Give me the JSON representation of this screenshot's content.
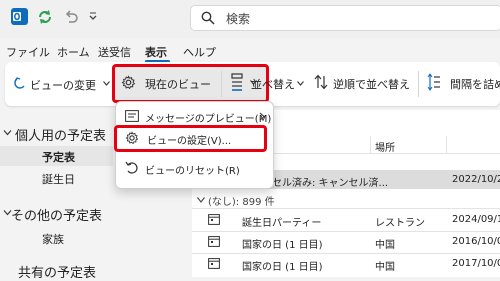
{
  "titlebar": {
    "search_placeholder": "検索"
  },
  "menu_tabs": [
    {
      "label": "ファイル"
    },
    {
      "label": "ホーム"
    },
    {
      "label": "送受信"
    },
    {
      "label": "表示"
    },
    {
      "label": "ヘルプ"
    }
  ],
  "ribbon": {
    "change_view": "ビューの変更",
    "current_view": "現在のビュー",
    "arrange": "並べ替え",
    "reverse_sort": "逆順で並べ替え",
    "spacing": "間隔を詰め"
  },
  "dropdown_menu": {
    "items": [
      {
        "label": "メッセージのプレビュー(M)"
      },
      {
        "label": "ビューの設定(V)..."
      },
      {
        "label": "ビューのリセット(R)"
      }
    ]
  },
  "left_pane": {
    "groups": [
      {
        "label": "個人用の予定表",
        "items": [
          "予定表",
          "誕生日"
        ]
      },
      {
        "label": "その他の予定表",
        "items": [
          "家族"
        ]
      },
      {
        "label": "共有の予定表",
        "items": []
      }
    ]
  },
  "list": {
    "column_location": "場所",
    "partial_text_top": "件",
    "cancel_row": {
      "subject": "キャンセル済み: キャンセル済...",
      "date": "2022/10/2"
    },
    "group_header": "(なし): 899 件",
    "rows": [
      {
        "subject": "誕生日パーティー",
        "location": "レストラン",
        "date": "2024/09/12"
      },
      {
        "subject": "国家の日 (1 日目)",
        "location": "中国",
        "date": "2016/10/0"
      },
      {
        "subject": "国家の日 (1 日目)",
        "location": "中国",
        "date": "2017/10/0"
      }
    ]
  },
  "colors": {
    "accent": "#0f6cbd",
    "highlight_border": "#e60012",
    "ribbon_bg": "#ffffff",
    "page_bg": "#f3f3f3"
  }
}
